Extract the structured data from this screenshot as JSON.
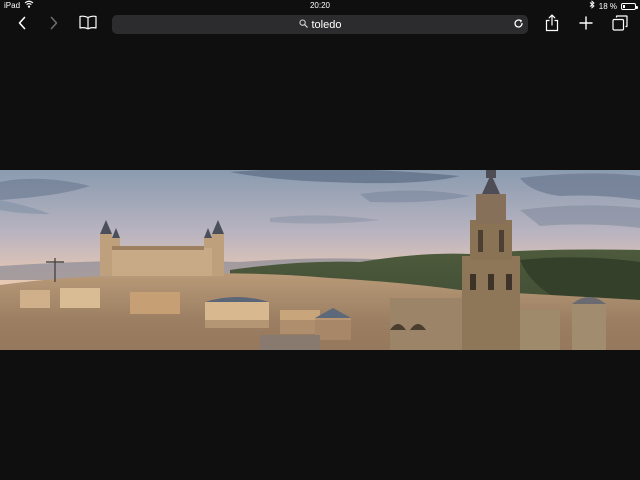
{
  "status": {
    "device": "iPad",
    "time": "20:20",
    "battery_text": "18 %",
    "battery_level": 0.18
  },
  "toolbar": {
    "back_icon": "chevron-left-icon",
    "forward_icon": "chevron-right-icon",
    "bookmarks_icon": "book-icon",
    "share_icon": "share-icon",
    "new_tab_icon": "plus-icon",
    "tabs_icon": "tabs-icon"
  },
  "address": {
    "query": "toledo",
    "search_icon": "search-icon",
    "reload_icon": "reload-icon"
  },
  "colors": {
    "background": "#0f0f0f",
    "address_bar": "#2c2c2e"
  }
}
